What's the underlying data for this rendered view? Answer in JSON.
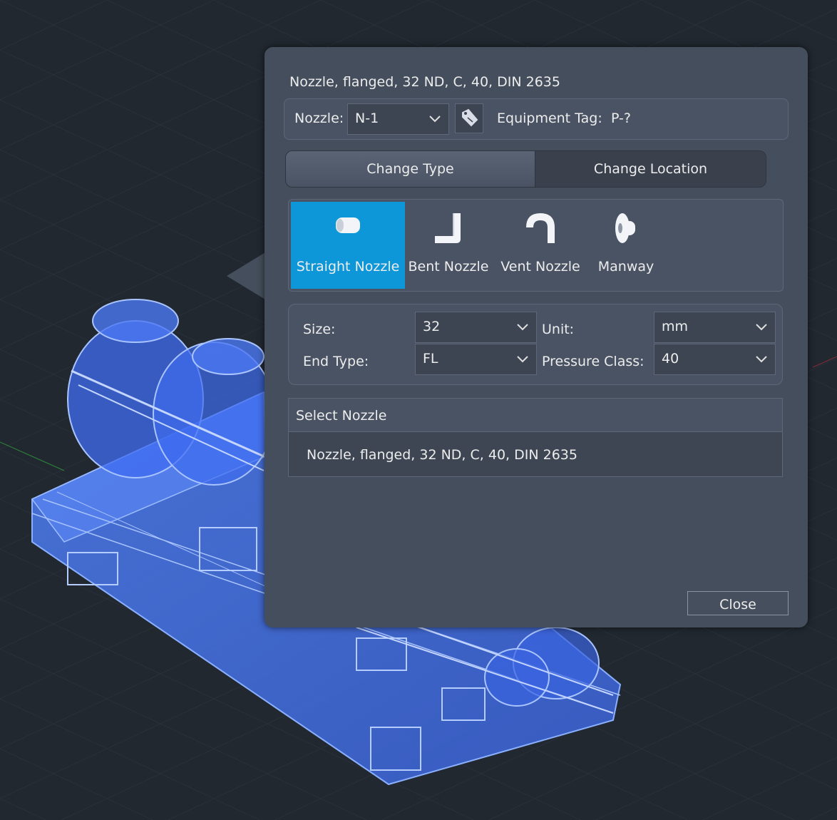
{
  "panel": {
    "title": "Nozzle, flanged, 32 ND, C, 40, DIN 2635",
    "nozzle_label": "Nozzle:",
    "nozzle_value": "N-1",
    "equipment_tag_label": "Equipment Tag:",
    "equipment_tag_value": "P-?",
    "tabs": [
      {
        "label": "Change Type",
        "active": true
      },
      {
        "label": "Change Location",
        "active": false
      }
    ],
    "nozzle_types": [
      {
        "label": "Straight Nozzle",
        "icon": "straight-nozzle-icon",
        "selected": true
      },
      {
        "label": "Bent Nozzle",
        "icon": "bent-nozzle-icon",
        "selected": false
      },
      {
        "label": "Vent Nozzle",
        "icon": "vent-nozzle-icon",
        "selected": false
      },
      {
        "label": "Manway",
        "icon": "manway-icon",
        "selected": false
      }
    ],
    "properties": {
      "size_label": "Size:",
      "size_value": "32",
      "unit_label": "Unit:",
      "unit_value": "mm",
      "end_type_label": "End Type:",
      "end_type_value": "FL",
      "pressure_class_label": "Pressure Class:",
      "pressure_class_value": "40"
    },
    "select_nozzle": {
      "header": "Select Nozzle",
      "items": [
        "Nozzle, flanged, 32 ND, C, 40, DIN 2635"
      ]
    },
    "close_label": "Close"
  },
  "colors": {
    "accent": "#0d96d8",
    "panel_bg": "#454e5c",
    "viewport_bg": "#212830",
    "model_wireframe": "#3a7cff"
  }
}
